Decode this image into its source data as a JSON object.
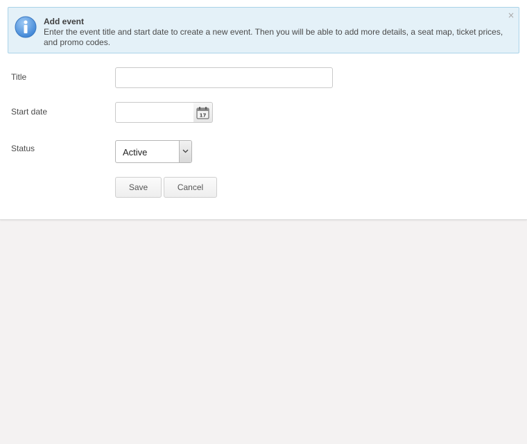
{
  "notice": {
    "title": "Add event",
    "message": "Enter the event title and start date to create a new event. Then you will be able to add more details, a seat map, ticket prices, and promo codes.",
    "close_glyph": "×",
    "icon": "info-icon"
  },
  "form": {
    "title_label": "Title",
    "title_value": "",
    "start_date_label": "Start date",
    "start_date_value": "",
    "calendar_icon": "calendar-icon",
    "calendar_day": "17",
    "status_label": "Status",
    "status_value": "Active"
  },
  "actions": {
    "save_label": "Save",
    "cancel_label": "Cancel"
  },
  "colors": {
    "notice_bg": "#e4f1f8",
    "notice_border": "#a9d3e8",
    "info_icon": "#5b9fe0",
    "page_bg": "#f4f2f2"
  }
}
